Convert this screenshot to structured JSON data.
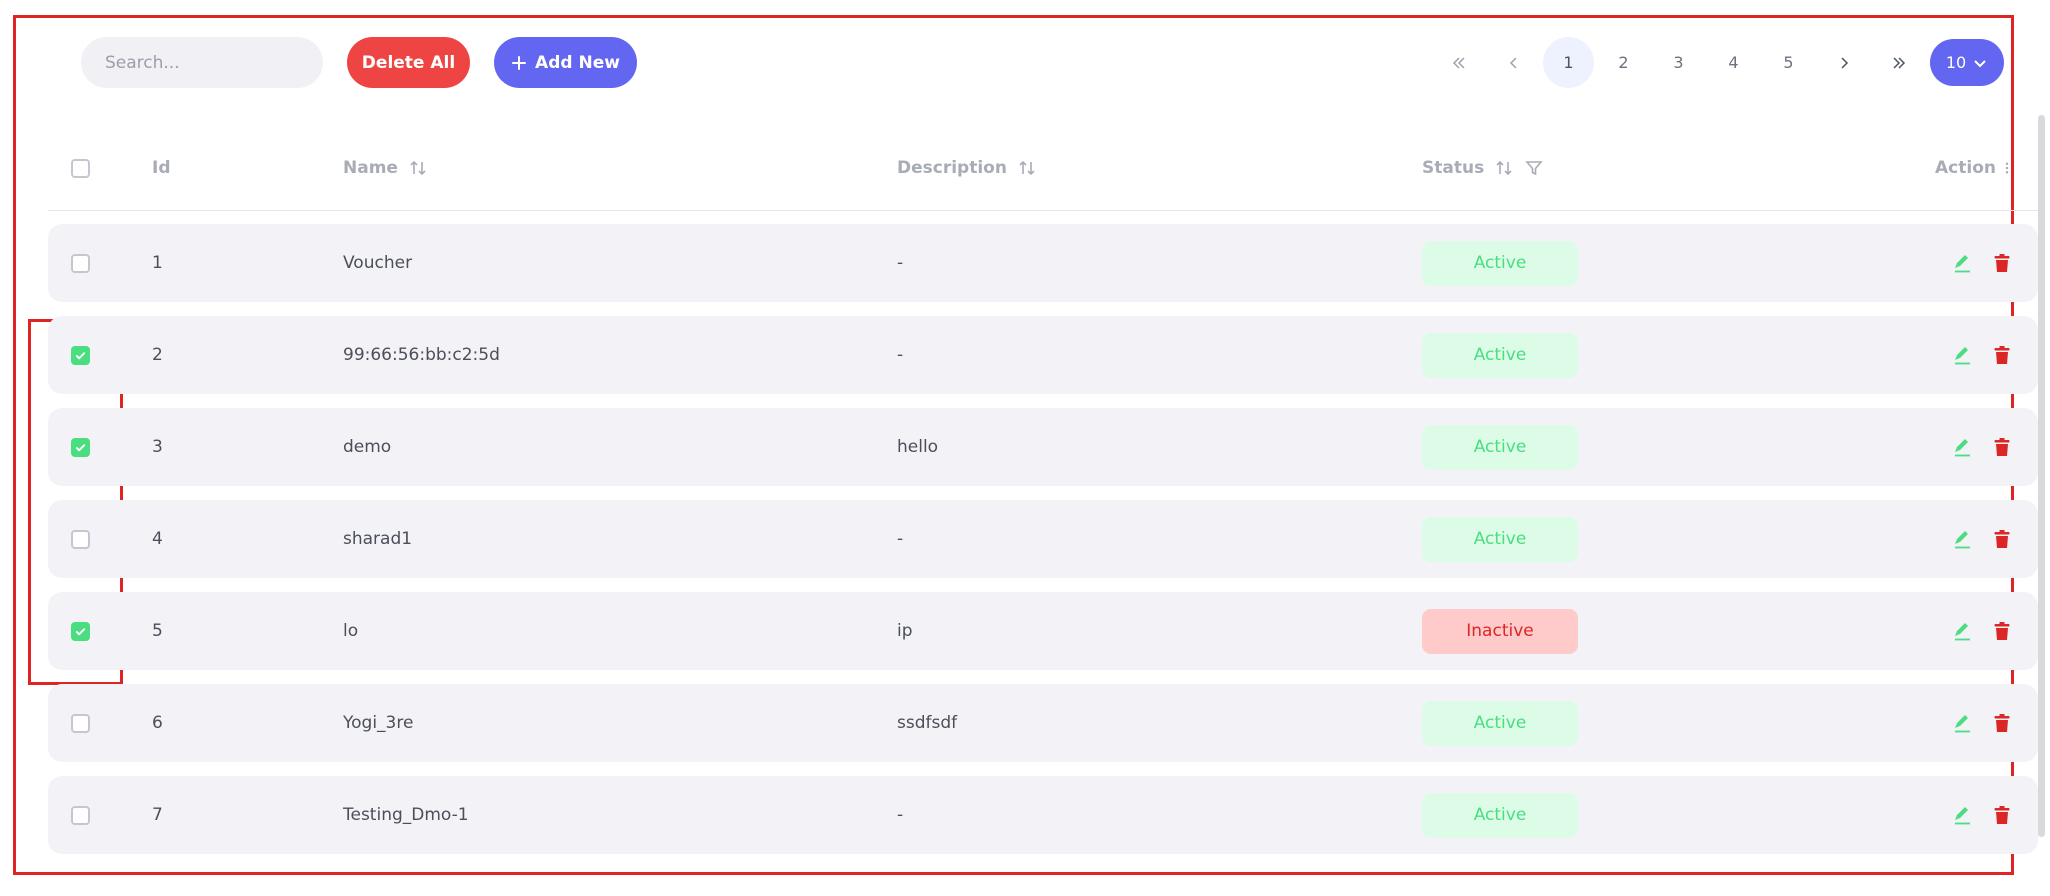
{
  "toolbar": {
    "search_placeholder": "Search...",
    "delete_all_label": "Delete All",
    "add_new_label": "Add New"
  },
  "pagination": {
    "pages": [
      "1",
      "2",
      "3",
      "4",
      "5"
    ],
    "current_page": "1",
    "rows_per_page": "10"
  },
  "table": {
    "headers": {
      "id": "Id",
      "name": "Name",
      "description": "Description",
      "status": "Status",
      "action": "Action"
    },
    "rows": [
      {
        "id": "1",
        "name": "Voucher",
        "description": "-",
        "status": "Active",
        "checked": false
      },
      {
        "id": "2",
        "name": "99:66:56:bb:c2:5d",
        "description": "-",
        "status": "Active",
        "checked": true
      },
      {
        "id": "3",
        "name": "demo",
        "description": "hello",
        "status": "Active",
        "checked": true
      },
      {
        "id": "4",
        "name": "sharad1",
        "description": "-",
        "status": "Active",
        "checked": false
      },
      {
        "id": "5",
        "name": "lo",
        "description": "ip",
        "status": "Inactive",
        "checked": true
      },
      {
        "id": "6",
        "name": "Yogi_3re",
        "description": "ssdfsdf",
        "status": "Active",
        "checked": false
      },
      {
        "id": "7",
        "name": "Testing_Dmo-1",
        "description": "-",
        "status": "Active",
        "checked": false
      }
    ]
  },
  "colors": {
    "delete_button": "#ef4444",
    "primary": "#6366f1",
    "active_badge_bg": "#dcfce7",
    "active_badge_text": "#4ade80",
    "inactive_badge_bg": "#fecaca",
    "inactive_badge_text": "#dc2626",
    "edit_icon": "#4ade80",
    "trash_icon": "#dc2626",
    "highlight_frame": "#e02424"
  },
  "icons": [
    "plus-icon",
    "first-page-icon",
    "prev-page-icon",
    "next-page-icon",
    "last-page-icon",
    "chevron-down-icon",
    "sort-icon",
    "filter-icon",
    "kebab-menu-icon",
    "edit-icon",
    "trash-icon",
    "check-icon"
  ]
}
